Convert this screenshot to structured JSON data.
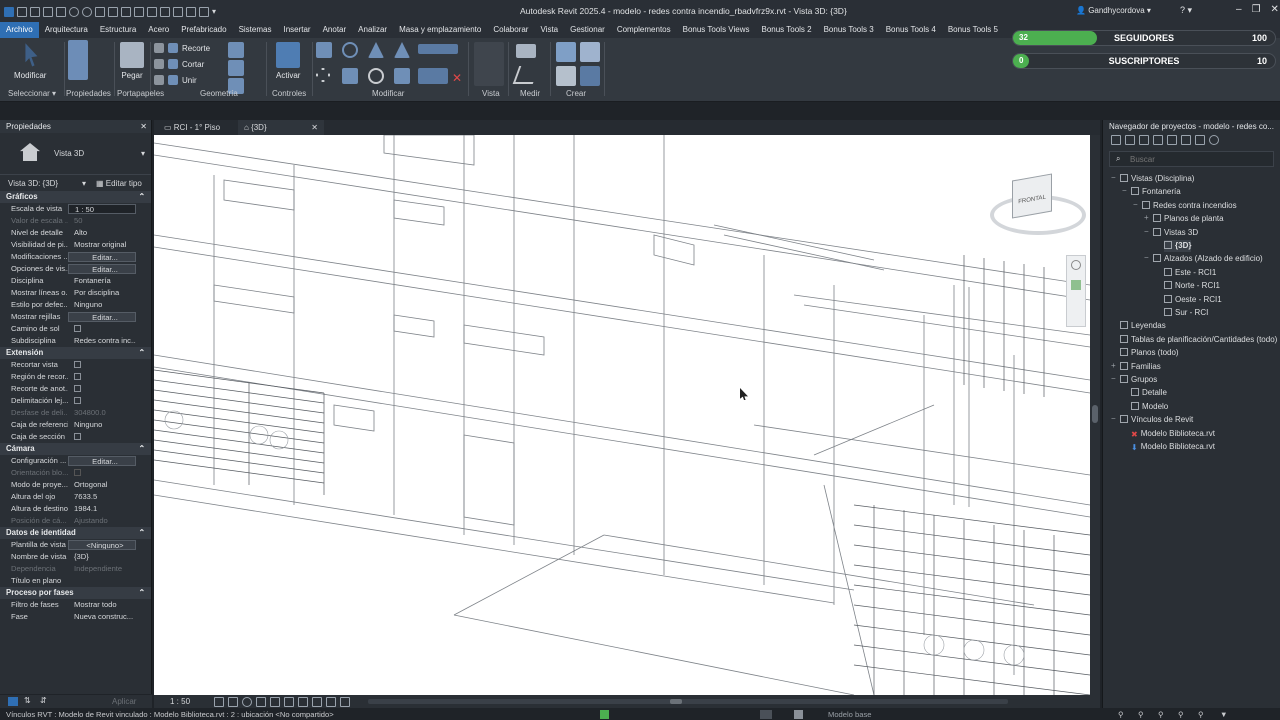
{
  "window": {
    "title": "Autodesk Revit 2025.4 - modelo - redes contra incendio_rbadvfrz9x.rvt - Vista 3D: {3D}",
    "user": "Gandhycordova",
    "help": "?"
  },
  "menu": [
    "Archivo",
    "Arquitectura",
    "Estructura",
    "Acero",
    "Prefabricado",
    "Sistemas",
    "Insertar",
    "Anotar",
    "Analizar",
    "Masa y emplazamiento",
    "Colaborar",
    "Vista",
    "Gestionar",
    "Complementos",
    "Bonus Tools Views",
    "Bonus Tools 2",
    "Bonus Tools 3",
    "Bonus Tools 4",
    "Bonus Tools 5"
  ],
  "ribbon": {
    "modify": "Modificar",
    "paste": "Pegar",
    "cope": "Recorte",
    "cut": "Cortar",
    "join": "Unir",
    "activate": "Activar",
    "groups": [
      "Seleccionar",
      "Propiedades",
      "Portapapeles",
      "Geometría",
      "Controles",
      "Modificar",
      "Vista",
      "Medir",
      "Crear"
    ]
  },
  "social": {
    "followers_label": "SEGUIDORES",
    "followers_count": "32",
    "followers_goal": "100",
    "followers_fraction": 0.32,
    "subs_label": "SUSCRIPTORES",
    "subs_count": "0",
    "subs_goal": "10",
    "subs_fraction": 0.0
  },
  "properties": {
    "header": "Propiedades",
    "type_name": "Vista 3D",
    "instance": "Vista 3D: {3D}",
    "edit_type": "Editar tipo",
    "apply": "Aplicar",
    "sections": [
      {
        "title": "Gráficos",
        "rows": [
          {
            "k": "Escala de vista",
            "v": "1 : 50",
            "kind": "field"
          },
          {
            "k": "Valor de escala ...",
            "v": "50",
            "kind": "dis"
          },
          {
            "k": "Nivel de detalle",
            "v": "Alto"
          },
          {
            "k": "Visibilidad de pi...",
            "v": "Mostrar original"
          },
          {
            "k": "Modificaciones ...",
            "v": "Editar...",
            "kind": "btn"
          },
          {
            "k": "Opciones de vis...",
            "v": "Editar...",
            "kind": "btn"
          },
          {
            "k": "Disciplina",
            "v": "Fontanería"
          },
          {
            "k": "Mostrar líneas o...",
            "v": "Por disciplina"
          },
          {
            "k": "Estilo por defec...",
            "v": "Ninguno"
          },
          {
            "k": "Mostrar rejillas",
            "v": "Editar...",
            "kind": "btn"
          },
          {
            "k": "Camino de sol",
            "v": "",
            "kind": "chk"
          },
          {
            "k": "Subdisciplina",
            "v": "Redes contra inc..."
          }
        ]
      },
      {
        "title": "Extensión",
        "rows": [
          {
            "k": "Recortar vista",
            "v": "",
            "kind": "chk"
          },
          {
            "k": "Región de recor...",
            "v": "",
            "kind": "chk"
          },
          {
            "k": "Recorte de anot...",
            "v": "",
            "kind": "chk"
          },
          {
            "k": "Delimitación lej...",
            "v": "",
            "kind": "chk"
          },
          {
            "k": "Desfase de deli...",
            "v": "304800.0",
            "kind": "dis"
          },
          {
            "k": "Caja de referencia",
            "v": "Ninguno"
          },
          {
            "k": "Caja de sección",
            "v": "",
            "kind": "chk"
          }
        ]
      },
      {
        "title": "Cámara",
        "rows": [
          {
            "k": "Configuración ...",
            "v": "Editar...",
            "kind": "btn"
          },
          {
            "k": "Orientación blo...",
            "v": "",
            "kind": "dischk"
          },
          {
            "k": "Modo de proye...",
            "v": "Ortogonal"
          },
          {
            "k": "Altura del ojo",
            "v": "7633.5"
          },
          {
            "k": "Altura de destino",
            "v": "1984.1"
          },
          {
            "k": "Posición de cá...",
            "v": "Ajustando",
            "kind": "dis"
          }
        ]
      },
      {
        "title": "Datos de identidad",
        "rows": [
          {
            "k": "Plantilla de vista",
            "v": "<Ninguno>",
            "kind": "btn"
          },
          {
            "k": "Nombre de vista",
            "v": "{3D}"
          },
          {
            "k": "Dependencia",
            "v": "Independiente",
            "kind": "dis"
          },
          {
            "k": "Título en plano",
            "v": ""
          }
        ]
      },
      {
        "title": "Proceso por fases",
        "rows": [
          {
            "k": "Filtro de fases",
            "v": "Mostrar todo"
          },
          {
            "k": "Fase",
            "v": "Nueva construc..."
          }
        ]
      }
    ]
  },
  "view_tabs": [
    {
      "label": "RCI - 1° Piso"
    },
    {
      "label": "{3D}",
      "active": true
    }
  ],
  "view_scale": "1 : 50",
  "viewcube": "FRONTAL",
  "browser": {
    "header": "Navegador de proyectos - modelo - redes co...",
    "search_placeholder": "Buscar",
    "items": [
      {
        "t": "Vistas (Disciplina)",
        "lvl": 0,
        "tw": "−"
      },
      {
        "t": "Fontanería",
        "lvl": 1,
        "tw": "−"
      },
      {
        "t": "Redes contra incendios",
        "lvl": 2,
        "tw": "−"
      },
      {
        "t": "Planos de planta",
        "lvl": 3,
        "tw": "+"
      },
      {
        "t": "Vistas 3D",
        "lvl": 3,
        "tw": "−"
      },
      {
        "t": "{3D}",
        "lvl": 4,
        "tw": "",
        "sel": true
      },
      {
        "t": "Alzados (Alzado de edificio)",
        "lvl": 3,
        "tw": "−"
      },
      {
        "t": "Este - RCI1",
        "lvl": 4,
        "tw": ""
      },
      {
        "t": "Norte - RCI1",
        "lvl": 4,
        "tw": ""
      },
      {
        "t": "Oeste - RCI1",
        "lvl": 4,
        "tw": ""
      },
      {
        "t": "Sur - RCI",
        "lvl": 4,
        "tw": ""
      },
      {
        "t": "Leyendas",
        "lvl": 0,
        "tw": ""
      },
      {
        "t": "Tablas de planificación/Cantidades (todo)",
        "lvl": 0,
        "tw": ""
      },
      {
        "t": "Planos (todo)",
        "lvl": 0,
        "tw": ""
      },
      {
        "t": "Familias",
        "lvl": 0,
        "tw": "+"
      },
      {
        "t": "Grupos",
        "lvl": 0,
        "tw": "−"
      },
      {
        "t": "Detalle",
        "lvl": 1,
        "tw": ""
      },
      {
        "t": "Modelo",
        "lvl": 1,
        "tw": ""
      },
      {
        "t": "Vínculos de Revit",
        "lvl": 0,
        "tw": "−"
      },
      {
        "t": "Modelo Biblioteca.rvt",
        "lvl": 1,
        "tw": "",
        "err": true
      },
      {
        "t": "Modelo Biblioteca.rvt",
        "lvl": 1,
        "tw": "",
        "pin": true
      }
    ]
  },
  "status": {
    "text": "Vínculos RVT : Modelo de Revit vinculado : Modelo Biblioteca.rvt : 2 : ubicación <No compartido>",
    "model": "Modelo base"
  },
  "colors": {
    "accent": "#2f6fb4",
    "progress": "#4caf50"
  }
}
